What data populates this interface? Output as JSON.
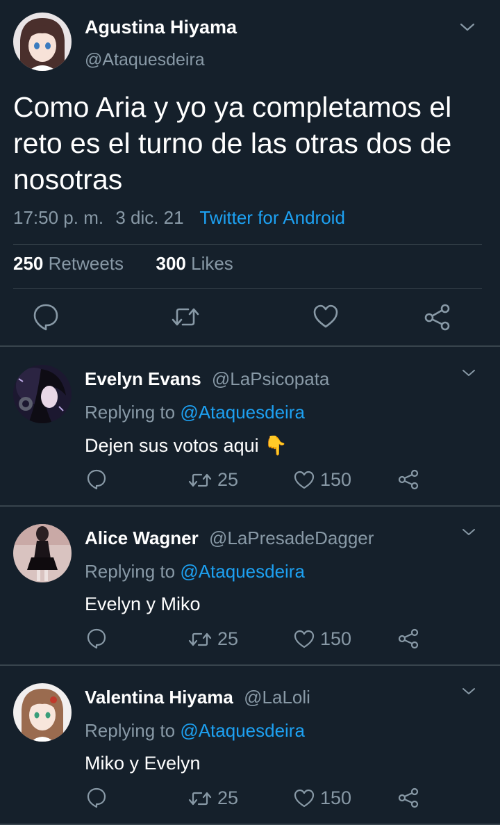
{
  "main_tweet": {
    "author_name": "Agustina Hiyama",
    "handle": "@Ataquesdeira",
    "text": "Como Aria y yo ya completamos el reto es el turno de las otras dos de nosotras",
    "time": "17:50 p. m.",
    "date": "3 dic. 21",
    "source": "Twitter for Android",
    "retweets_count": "250",
    "retweets_label": "Retweets",
    "likes_count": "300",
    "likes_label": "Likes"
  },
  "replies": [
    {
      "name": "Evelyn Evans",
      "handle": "@LaPsicopata",
      "replying_prefix": "Replying to",
      "replying_to": "@Ataquesdeira",
      "text": "Dejen sus votos aqui",
      "emoji": "👇",
      "retweets": "25",
      "likes": "150"
    },
    {
      "name": "Alice Wagner",
      "handle": "@LaPresadeDagger",
      "replying_prefix": "Replying to",
      "replying_to": "@Ataquesdeira",
      "text": "Evelyn y Miko",
      "retweets": "25",
      "likes": "150"
    },
    {
      "name": "Valentina Hiyama",
      "handle": "@LaLoli",
      "replying_prefix": "Replying to",
      "replying_to": "@Ataquesdeira",
      "text": "Miko y Evelyn",
      "retweets": "25",
      "likes": "150"
    }
  ],
  "icons": {
    "reply": "reply-icon",
    "retweet": "retweet-icon",
    "like": "heart-icon",
    "share": "share-icon",
    "menu": "chevron-down-icon"
  },
  "colors": {
    "background": "#15202b",
    "accent": "#1da1f2",
    "muted": "#8899a6",
    "divider": "#38444d"
  }
}
